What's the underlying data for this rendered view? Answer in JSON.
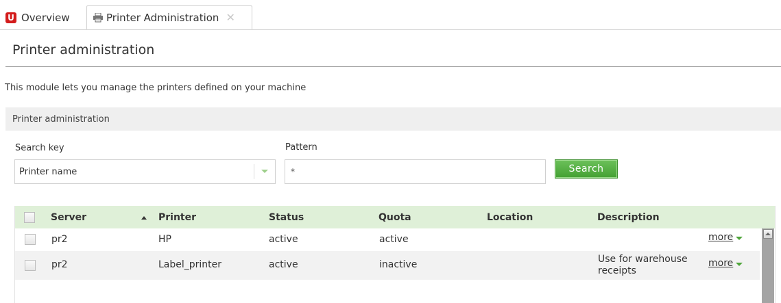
{
  "tabs": [
    {
      "label": "Overview"
    },
    {
      "label": "Printer Administration"
    }
  ],
  "header": {
    "title": "Printer administration",
    "intro": "This module lets you manage the printers defined on your machine"
  },
  "panel": {
    "title": "Printer administration"
  },
  "search": {
    "key_label": "Search key",
    "key_value": "Printer name",
    "pattern_label": "Pattern",
    "pattern_value": "*",
    "button_label": "Search"
  },
  "table": {
    "columns": [
      "Server",
      "Printer",
      "Status",
      "Quota",
      "Location",
      "Description"
    ],
    "rows": [
      {
        "server": "pr2",
        "printer": "HP",
        "status": "active",
        "quota": "active",
        "location": "",
        "description": "",
        "more": "more"
      },
      {
        "server": "pr2",
        "printer": "Label_printer",
        "status": "active",
        "quota": "inactive",
        "location": "",
        "description": "Use for warehouse receipts",
        "more": "more"
      }
    ]
  },
  "colors": {
    "accent_green": "#4fa53a",
    "header_green": "#dff0d8",
    "logo_red": "#d31c1c"
  }
}
